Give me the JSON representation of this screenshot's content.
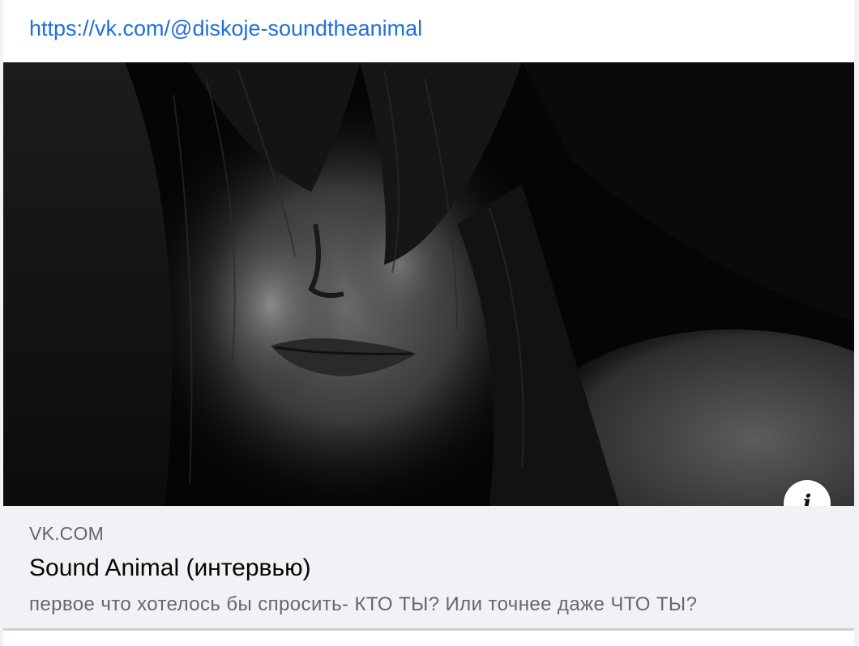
{
  "post": {
    "link_text": "https://vk.com/@diskoje-soundtheanimal"
  },
  "link_preview": {
    "image_alt": "Black and white close-up portrait of a woman with hair over her face",
    "info_icon": "info-icon",
    "info_glyph": "i",
    "domain": "VK.COM",
    "title": "Sound Animal (интервью)",
    "description": "первое что хотелось бы спросить- КТО ТЫ? Или точнее даже ЧТО ТЫ?"
  },
  "colors": {
    "link": "#216fdb",
    "caption_bg": "#f0f2f5",
    "secondary_text": "#65676b",
    "title_text": "#050505"
  }
}
